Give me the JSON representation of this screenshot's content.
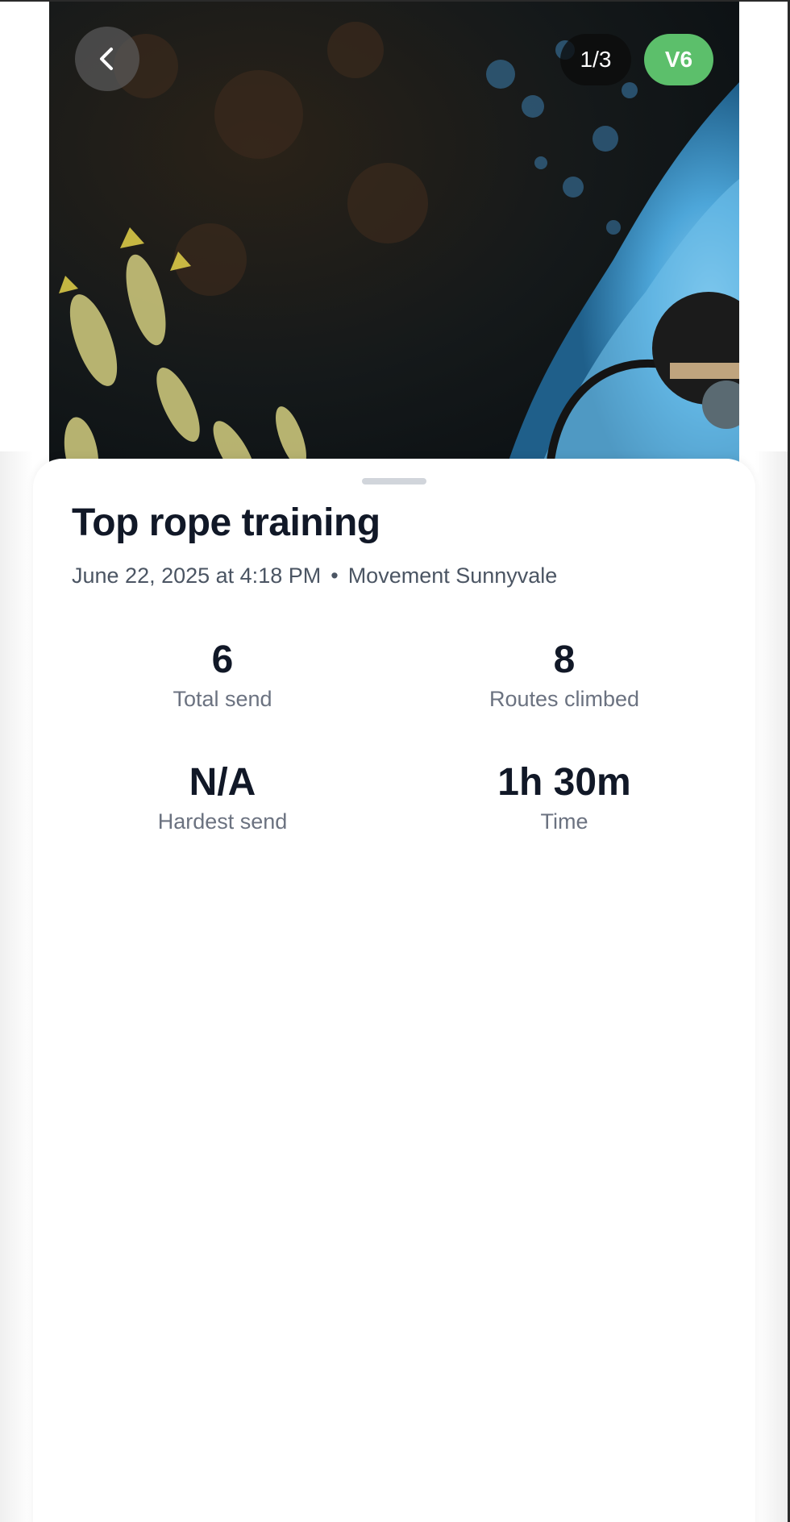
{
  "header": {
    "back_icon": "chevron-left-icon",
    "photo_counter": "1/3",
    "grade_badge": "V6",
    "grade_color": "#5cbf6b"
  },
  "session": {
    "title": "Top rope training",
    "date": "June 22, 2025 at 4:18 PM",
    "separator": "•",
    "location": "Movement Sunnyvale"
  },
  "stats": [
    {
      "value": "6",
      "label": "Total send"
    },
    {
      "value": "8",
      "label": "Routes climbed"
    },
    {
      "value": "N/A",
      "label": "Hardest send"
    },
    {
      "value": "1h 30m",
      "label": "Time"
    }
  ]
}
